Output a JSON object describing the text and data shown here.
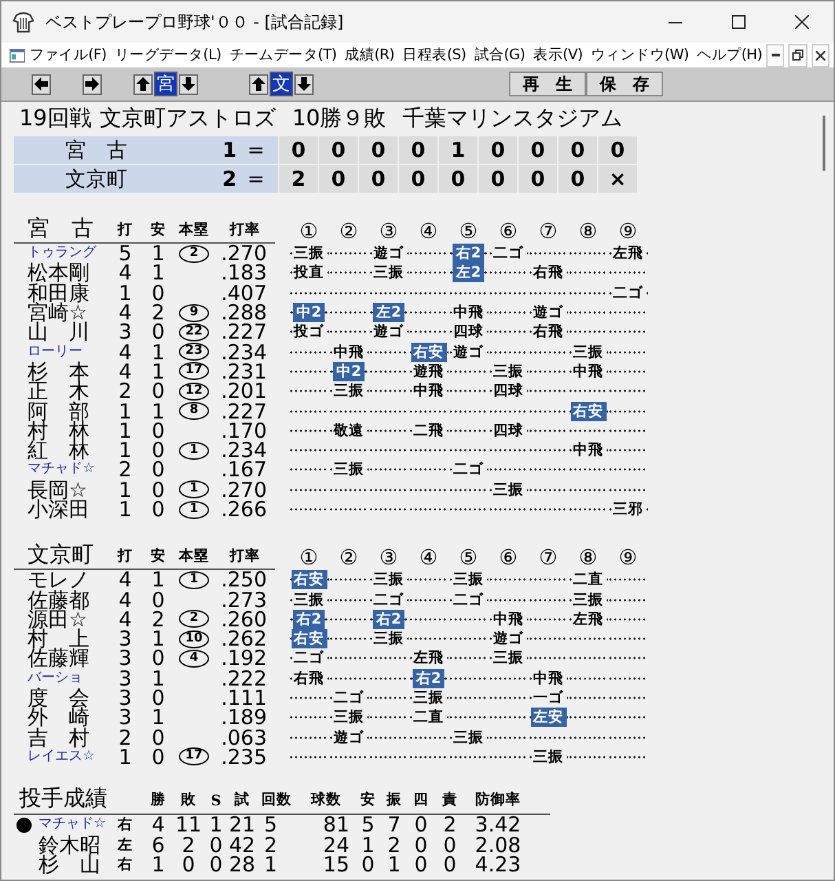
{
  "window": {
    "title": "ベストプレープロ野球'００ - [試合記録]"
  },
  "menu": [
    "ファイル(F)",
    "リーグデータ(L)",
    "チームデータ(T)",
    "成績(R)",
    "日程表(S)",
    "試合(G)",
    "表示(V)",
    "ウィンドウ(W)",
    "ヘルプ(H)"
  ],
  "toolbar": {
    "away": "宮",
    "home": "文",
    "buttons": [
      "再　生",
      "保　存"
    ]
  },
  "game_info": {
    "game": "19回戦",
    "team": "文京町アストロズ",
    "record": "10勝９敗",
    "stadium": "千葉マリンスタジアム"
  },
  "scoreboard": [
    {
      "team": "宮　古",
      "total": "1",
      "sign": "=",
      "innings": [
        "0",
        "0",
        "0",
        "0",
        "1",
        "0",
        "0",
        "0",
        "0"
      ]
    },
    {
      "team": "文京町",
      "total": "2",
      "sign": "=",
      "innings": [
        "2",
        "0",
        "0",
        "0",
        "0",
        "0",
        "0",
        "0",
        "×"
      ]
    }
  ],
  "batting": [
    {
      "team": "宮　古",
      "headers": [
        "打",
        "安",
        "本塁",
        "打率"
      ],
      "innings": [
        "①",
        "②",
        "③",
        "④",
        "⑤",
        "⑥",
        "⑦",
        "⑧",
        "⑨"
      ],
      "batters": [
        {
          "name": "トゥラング",
          "foreign": true,
          "ab": "5",
          "h": "1",
          "hr": "2",
          "avg": ".270",
          "results": [
            {
              "kind": "out",
              "text": "三振"
            },
            {
              "kind": "blank"
            },
            {
              "kind": "out",
              "text": "遊ゴ"
            },
            {
              "kind": "blank"
            },
            {
              "kind": "hit",
              "text": "右2"
            },
            {
              "kind": "out",
              "text": "二ゴ"
            },
            {
              "kind": "blank"
            },
            {
              "kind": "blank"
            },
            {
              "kind": "out",
              "text": "左飛"
            }
          ]
        },
        {
          "name": "松本剛",
          "foreign": false,
          "ab": "4",
          "h": "1",
          "avg": ".183",
          "results": [
            {
              "kind": "out",
              "text": "投直"
            },
            {
              "kind": "blank"
            },
            {
              "kind": "out",
              "text": "三振"
            },
            {
              "kind": "blank"
            },
            {
              "kind": "hit",
              "text": "左2"
            },
            {
              "kind": "blank"
            },
            {
              "kind": "out",
              "text": "右飛"
            },
            {
              "kind": "blank"
            },
            {
              "kind": "blank"
            }
          ]
        },
        {
          "name": "和田康",
          "foreign": false,
          "ab": "1",
          "h": "0",
          "avg": ".407",
          "results": [
            {
              "kind": "blank"
            },
            {
              "kind": "blank"
            },
            {
              "kind": "blank"
            },
            {
              "kind": "blank"
            },
            {
              "kind": "blank"
            },
            {
              "kind": "blank"
            },
            {
              "kind": "blank"
            },
            {
              "kind": "blank"
            },
            {
              "kind": "out",
              "text": "二ゴ"
            }
          ]
        },
        {
          "name": "宮崎☆",
          "foreign": false,
          "ab": "4",
          "h": "2",
          "hr": "9",
          "avg": ".288",
          "results": [
            {
              "kind": "hit",
              "text": "中2"
            },
            {
              "kind": "blank"
            },
            {
              "kind": "hit",
              "text": "左2"
            },
            {
              "kind": "blank"
            },
            {
              "kind": "out",
              "text": "中飛"
            },
            {
              "kind": "blank"
            },
            {
              "kind": "out",
              "text": "遊ゴ"
            },
            {
              "kind": "blank"
            },
            {
              "kind": "blank"
            }
          ]
        },
        {
          "name": "山　川",
          "foreign": false,
          "ab": "3",
          "h": "0",
          "hr": "22",
          "avg": ".227",
          "results": [
            {
              "kind": "out",
              "text": "投ゴ"
            },
            {
              "kind": "blank"
            },
            {
              "kind": "out",
              "text": "遊ゴ"
            },
            {
              "kind": "blank"
            },
            {
              "kind": "out",
              "text": "四球"
            },
            {
              "kind": "blank"
            },
            {
              "kind": "out",
              "text": "右飛"
            },
            {
              "kind": "blank"
            },
            {
              "kind": "blank"
            }
          ]
        },
        {
          "name": "ローリー",
          "foreign": true,
          "ab": "4",
          "h": "1",
          "hr": "23",
          "avg": ".234",
          "results": [
            {
              "kind": "blank"
            },
            {
              "kind": "out",
              "text": "中飛"
            },
            {
              "kind": "blank"
            },
            {
              "kind": "hit",
              "text": "右安"
            },
            {
              "kind": "out",
              "text": "遊ゴ"
            },
            {
              "kind": "blank"
            },
            {
              "kind": "blank"
            },
            {
              "kind": "out",
              "text": "三振"
            },
            {
              "kind": "blank"
            }
          ]
        },
        {
          "name": "杉　本",
          "foreign": false,
          "ab": "4",
          "h": "1",
          "hr": "17",
          "avg": ".231",
          "results": [
            {
              "kind": "blank"
            },
            {
              "kind": "hit",
              "text": "中2"
            },
            {
              "kind": "blank"
            },
            {
              "kind": "out",
              "text": "遊飛"
            },
            {
              "kind": "blank"
            },
            {
              "kind": "out",
              "text": "三振"
            },
            {
              "kind": "blank"
            },
            {
              "kind": "out",
              "text": "中飛"
            },
            {
              "kind": "blank"
            }
          ]
        },
        {
          "name": "正　木",
          "foreign": false,
          "ab": "2",
          "h": "0",
          "hr": "12",
          "avg": ".201",
          "results": [
            {
              "kind": "blank"
            },
            {
              "kind": "out",
              "text": "三振"
            },
            {
              "kind": "blank"
            },
            {
              "kind": "out",
              "text": "中飛"
            },
            {
              "kind": "blank"
            },
            {
              "kind": "out",
              "text": "四球"
            },
            {
              "kind": "blank"
            },
            {
              "kind": "blank"
            },
            {
              "kind": "blank"
            }
          ]
        },
        {
          "name": "阿　部",
          "foreign": false,
          "ab": "1",
          "h": "1",
          "hr": "8",
          "avg": ".227",
          "results": [
            {
              "kind": "blank"
            },
            {
              "kind": "blank"
            },
            {
              "kind": "blank"
            },
            {
              "kind": "blank"
            },
            {
              "kind": "blank"
            },
            {
              "kind": "blank"
            },
            {
              "kind": "blank"
            },
            {
              "kind": "hit",
              "text": "右安"
            },
            {
              "kind": "blank"
            }
          ]
        },
        {
          "name": "村　林",
          "foreign": false,
          "ab": "1",
          "h": "0",
          "avg": ".170",
          "results": [
            {
              "kind": "blank"
            },
            {
              "kind": "out",
              "text": "敬遠"
            },
            {
              "kind": "blank"
            },
            {
              "kind": "out",
              "text": "二飛"
            },
            {
              "kind": "blank"
            },
            {
              "kind": "out",
              "text": "四球"
            },
            {
              "kind": "blank"
            },
            {
              "kind": "blank"
            },
            {
              "kind": "blank"
            }
          ]
        },
        {
          "name": "紅　林",
          "foreign": false,
          "ab": "1",
          "h": "0",
          "hr": "1",
          "avg": ".234",
          "results": [
            {
              "kind": "blank"
            },
            {
              "kind": "blank"
            },
            {
              "kind": "blank"
            },
            {
              "kind": "blank"
            },
            {
              "kind": "blank"
            },
            {
              "kind": "blank"
            },
            {
              "kind": "blank"
            },
            {
              "kind": "out",
              "text": "中飛"
            },
            {
              "kind": "blank"
            }
          ]
        },
        {
          "name": "マチャド☆",
          "foreign": true,
          "ab": "2",
          "h": "0",
          "avg": ".167",
          "results": [
            {
              "kind": "blank"
            },
            {
              "kind": "out",
              "text": "三振"
            },
            {
              "kind": "blank"
            },
            {
              "kind": "blank"
            },
            {
              "kind": "out",
              "text": "二ゴ"
            },
            {
              "kind": "blank"
            },
            {
              "kind": "blank"
            },
            {
              "kind": "blank"
            },
            {
              "kind": "blank"
            }
          ]
        },
        {
          "name": "長岡☆",
          "foreign": false,
          "ab": "1",
          "h": "0",
          "hr": "1",
          "avg": ".270",
          "results": [
            {
              "kind": "blank"
            },
            {
              "kind": "blank"
            },
            {
              "kind": "blank"
            },
            {
              "kind": "blank"
            },
            {
              "kind": "blank"
            },
            {
              "kind": "out",
              "text": "三振"
            },
            {
              "kind": "blank"
            },
            {
              "kind": "blank"
            },
            {
              "kind": "blank"
            }
          ]
        },
        {
          "name": "小深田",
          "foreign": false,
          "ab": "1",
          "h": "0",
          "hr": "1",
          "avg": ".266",
          "results": [
            {
              "kind": "blank"
            },
            {
              "kind": "blank"
            },
            {
              "kind": "blank"
            },
            {
              "kind": "blank"
            },
            {
              "kind": "blank"
            },
            {
              "kind": "blank"
            },
            {
              "kind": "blank"
            },
            {
              "kind": "blank"
            },
            {
              "kind": "out",
              "text": "三邪"
            }
          ]
        }
      ]
    },
    {
      "team": "文京町",
      "headers": [
        "打",
        "安",
        "本塁",
        "打率"
      ],
      "innings": [
        "①",
        "②",
        "③",
        "④",
        "⑤",
        "⑥",
        "⑦",
        "⑧",
        "⑨"
      ],
      "batters": [
        {
          "name": "モレノ",
          "foreign": false,
          "ab": "4",
          "h": "1",
          "hr": "1",
          "avg": ".250",
          "results": [
            {
              "kind": "hit",
              "text": "右安"
            },
            {
              "kind": "blank"
            },
            {
              "kind": "out",
              "text": "三振"
            },
            {
              "kind": "blank"
            },
            {
              "kind": "out",
              "text": "三振"
            },
            {
              "kind": "blank"
            },
            {
              "kind": "blank"
            },
            {
              "kind": "out",
              "text": "二直"
            },
            {
              "kind": "blank"
            }
          ]
        },
        {
          "name": "佐藤都",
          "foreign": false,
          "ab": "4",
          "h": "0",
          "avg": ".273",
          "results": [
            {
              "kind": "out",
              "text": "三振"
            },
            {
              "kind": "blank"
            },
            {
              "kind": "out",
              "text": "二ゴ"
            },
            {
              "kind": "blank"
            },
            {
              "kind": "out",
              "text": "二ゴ"
            },
            {
              "kind": "blank"
            },
            {
              "kind": "blank"
            },
            {
              "kind": "out",
              "text": "三振"
            },
            {
              "kind": "blank"
            }
          ]
        },
        {
          "name": "源田☆",
          "foreign": false,
          "ab": "4",
          "h": "2",
          "hr": "2",
          "avg": ".260",
          "results": [
            {
              "kind": "hit",
              "text": "右2"
            },
            {
              "kind": "blank"
            },
            {
              "kind": "hit",
              "text": "右2"
            },
            {
              "kind": "blank"
            },
            {
              "kind": "blank"
            },
            {
              "kind": "out",
              "text": "中飛"
            },
            {
              "kind": "blank"
            },
            {
              "kind": "out",
              "text": "左飛"
            },
            {
              "kind": "blank"
            }
          ]
        },
        {
          "name": "村　上",
          "foreign": false,
          "ab": "3",
          "h": "1",
          "hr": "10",
          "avg": ".262",
          "results": [
            {
              "kind": "hit",
              "text": "右安"
            },
            {
              "kind": "blank"
            },
            {
              "kind": "out",
              "text": "三振"
            },
            {
              "kind": "blank"
            },
            {
              "kind": "blank"
            },
            {
              "kind": "out",
              "text": "遊ゴ"
            },
            {
              "kind": "blank"
            },
            {
              "kind": "blank"
            },
            {
              "kind": "blank"
            }
          ]
        },
        {
          "name": "佐藤輝",
          "foreign": false,
          "ab": "3",
          "h": "0",
          "hr": "4",
          "avg": ".192",
          "results": [
            {
              "kind": "out",
              "text": "二ゴ"
            },
            {
              "kind": "blank"
            },
            {
              "kind": "blank"
            },
            {
              "kind": "out",
              "text": "左飛"
            },
            {
              "kind": "blank"
            },
            {
              "kind": "out",
              "text": "三振"
            },
            {
              "kind": "blank"
            },
            {
              "kind": "blank"
            },
            {
              "kind": "blank"
            }
          ]
        },
        {
          "name": "バーショ",
          "foreign": true,
          "ab": "3",
          "h": "1",
          "avg": ".222",
          "results": [
            {
              "kind": "out",
              "text": "右飛"
            },
            {
              "kind": "blank"
            },
            {
              "kind": "blank"
            },
            {
              "kind": "hit",
              "text": "右2"
            },
            {
              "kind": "blank"
            },
            {
              "kind": "blank"
            },
            {
              "kind": "out",
              "text": "中飛"
            },
            {
              "kind": "blank"
            },
            {
              "kind": "blank"
            }
          ]
        },
        {
          "name": "度　会",
          "foreign": false,
          "ab": "3",
          "h": "0",
          "avg": ".111",
          "results": [
            {
              "kind": "blank"
            },
            {
              "kind": "out",
              "text": "二ゴ"
            },
            {
              "kind": "blank"
            },
            {
              "kind": "out",
              "text": "三振"
            },
            {
              "kind": "blank"
            },
            {
              "kind": "blank"
            },
            {
              "kind": "out",
              "text": "一ゴ"
            },
            {
              "kind": "blank"
            },
            {
              "kind": "blank"
            }
          ]
        },
        {
          "name": "外　崎",
          "foreign": false,
          "ab": "3",
          "h": "1",
          "avg": ".189",
          "results": [
            {
              "kind": "blank"
            },
            {
              "kind": "out",
              "text": "三振"
            },
            {
              "kind": "blank"
            },
            {
              "kind": "out",
              "text": "二直"
            },
            {
              "kind": "blank"
            },
            {
              "kind": "blank"
            },
            {
              "kind": "hit",
              "text": "左安"
            },
            {
              "kind": "blank"
            },
            {
              "kind": "blank"
            }
          ]
        },
        {
          "name": "吉　村",
          "foreign": false,
          "ab": "2",
          "h": "0",
          "avg": ".063",
          "results": [
            {
              "kind": "blank"
            },
            {
              "kind": "out",
              "text": "遊ゴ"
            },
            {
              "kind": "blank"
            },
            {
              "kind": "blank"
            },
            {
              "kind": "out",
              "text": "三振"
            },
            {
              "kind": "blank"
            },
            {
              "kind": "blank"
            },
            {
              "kind": "blank"
            },
            {
              "kind": "blank"
            }
          ]
        },
        {
          "name": "レイエス☆",
          "foreign": true,
          "ab": "1",
          "h": "0",
          "hr": "17",
          "avg": ".235",
          "results": [
            {
              "kind": "blank"
            },
            {
              "kind": "blank"
            },
            {
              "kind": "blank"
            },
            {
              "kind": "blank"
            },
            {
              "kind": "blank"
            },
            {
              "kind": "blank"
            },
            {
              "kind": "out",
              "text": "三振"
            },
            {
              "kind": "blank"
            },
            {
              "kind": "blank"
            }
          ]
        }
      ]
    }
  ],
  "pitching": {
    "title": "投手成績",
    "headers": [
      "勝",
      "敗",
      "S",
      "試",
      "回数",
      "球数",
      "安",
      "振",
      "四",
      "責",
      "防御率"
    ],
    "pitchers": [
      {
        "name": "マチャド☆",
        "foreign": true,
        "current": true,
        "hand": "右",
        "stats": [
          "4",
          "11",
          "1",
          "21",
          "5",
          "81",
          "5",
          "7",
          "0",
          "2",
          "3.42"
        ]
      },
      {
        "name": "鈴木昭",
        "foreign": false,
        "current": false,
        "hand": "左",
        "stats": [
          "6",
          "2",
          "0",
          "42",
          "2",
          "24",
          "1",
          "2",
          "0",
          "0",
          "2.08"
        ]
      },
      {
        "name": "杉　山",
        "foreign": false,
        "current": false,
        "hand": "右",
        "stats": [
          "1",
          "0",
          "0",
          "28",
          "1",
          "15",
          "0",
          "1",
          "0",
          "0",
          "4.23"
        ]
      }
    ]
  }
}
